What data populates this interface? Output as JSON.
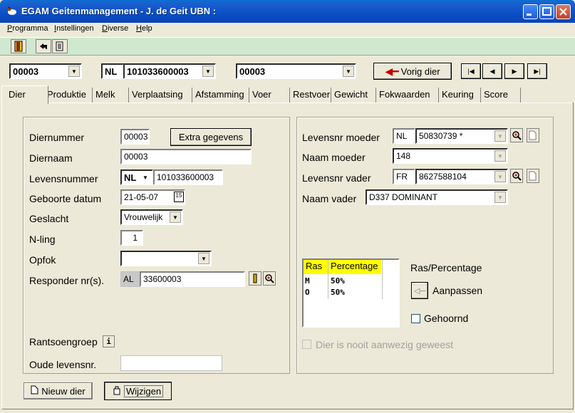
{
  "window": {
    "title": "EGAM Geitenmanagement - J. de Geit    UBN :"
  },
  "menu": {
    "items": [
      {
        "label": "Programma",
        "underline": "P"
      },
      {
        "label": "Instellingen",
        "underline": "I"
      },
      {
        "label": "Diverse",
        "underline": "D"
      },
      {
        "label": "Help",
        "underline": "H"
      }
    ]
  },
  "selectors": {
    "animal_combo": "00003",
    "country_combo": "NL",
    "life_number_combo": "101033600003",
    "name_combo": "00003",
    "previous_label": "Vorig dier"
  },
  "tabs": [
    "Dier",
    "Produktie",
    "Melk",
    "Verplaatsing",
    "Afstamming",
    "Voer",
    "Restvoer",
    "Gewicht",
    "Fokwaarden",
    "Keuring",
    "Score"
  ],
  "left": {
    "diernummer_label": "Diernummer",
    "diernummer_value": "00003",
    "extra_button": "Extra gegevens",
    "diernaam_label": "Diernaam",
    "diernaam_value": "00003",
    "levensnummer_label": "Levensnummer",
    "levensnummer_country": "NL",
    "levensnummer_value": "101033600003",
    "geboorte_label": "Geboorte datum",
    "geboorte_value": "21-05-07",
    "calendar_icon_text": "15",
    "geslacht_label": "Geslacht",
    "geslacht_value": "Vrouwelijk",
    "nling_label": "N-ling",
    "nling_value": "1",
    "opfok_label": "Opfok",
    "opfok_value": "",
    "responder_label": "Responder nr(s).",
    "responder_prefix": "AL",
    "responder_value": "33600003",
    "rantsoen_label": "Rantsoengroep",
    "oude_label": "Oude levensnr.",
    "oude_value": ""
  },
  "right": {
    "moeder_label": "Levensnr moeder",
    "moeder_country": "NL",
    "moeder_value": "50830739 *",
    "naam_moeder_label": "Naam moeder",
    "naam_moeder_value": "148",
    "vader_label": "Levensnr vader",
    "vader_country": "FR",
    "vader_value": "8627588104",
    "naam_vader_label": "Naam vader",
    "naam_vader_value": "D337 DOMINANT",
    "ras_header": "Ras",
    "perc_header": "Percentage",
    "ras_rows": [
      {
        "ras": "M",
        "perc": "50%"
      },
      {
        "ras": "O",
        "perc": "50%"
      }
    ],
    "ras_percentage_label": "Ras/Percentage",
    "aanpassen_label": "Aanpassen",
    "gehoornd_label": "Gehoornd",
    "nooit_label": "Dier is nooit aanwezig geweest"
  },
  "bottom": {
    "nieuw_label": "Nieuw dier",
    "wijzigen_label": "Wijzigen"
  }
}
